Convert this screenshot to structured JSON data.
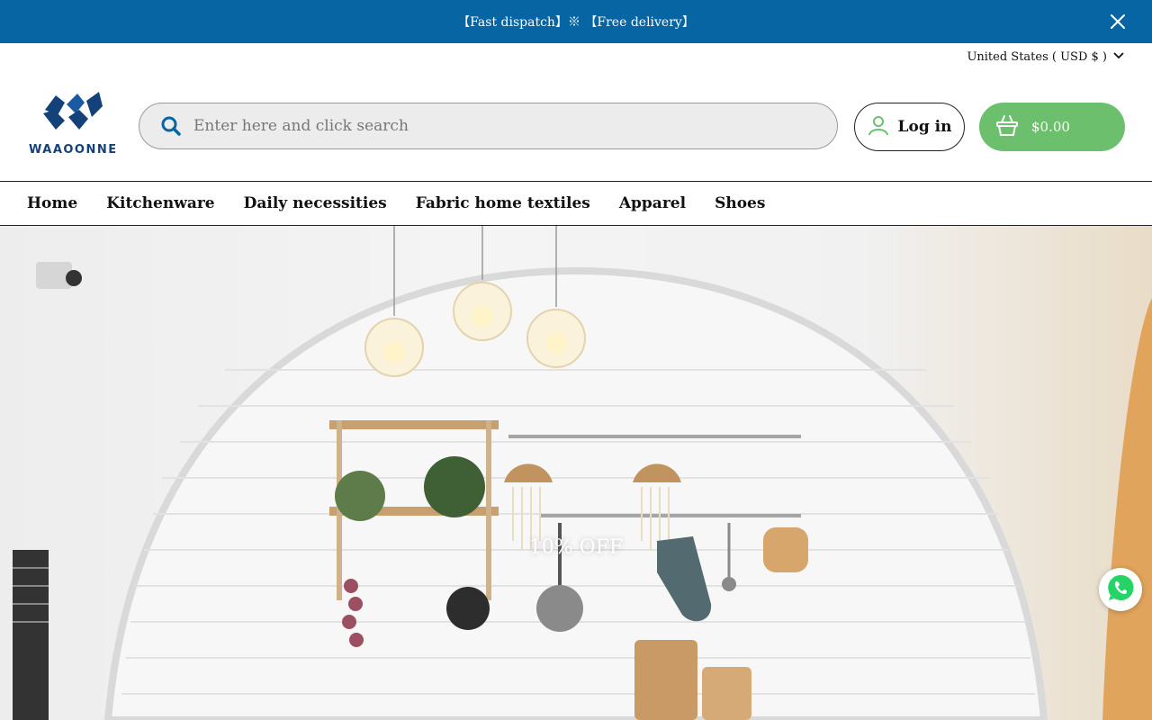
{
  "announcement": {
    "text": "【Fast dispatch】※ 【Free delivery】",
    "bg_color": "#0765a4"
  },
  "locale": {
    "label": "United States ( USD $ )"
  },
  "logo": {
    "text": "WAAOONNE",
    "color": "#13427a"
  },
  "search": {
    "placeholder": "Enter here and click search",
    "value": ""
  },
  "account": {
    "login_label": "Log in"
  },
  "cart": {
    "total": "$0.00",
    "bg_color": "#6cc06d"
  },
  "nav": {
    "items": [
      "Home",
      "Kitchenware",
      "Daily necessities",
      "Fabric home textiles",
      "Apparel",
      "Shoes"
    ]
  },
  "hero": {
    "caption": "10% OFF"
  },
  "icons": {
    "close": "close-icon",
    "chevron": "chevron-down-icon",
    "search": "search-icon",
    "user": "user-icon",
    "cart": "basket-icon",
    "chat": "whatsapp-icon"
  }
}
